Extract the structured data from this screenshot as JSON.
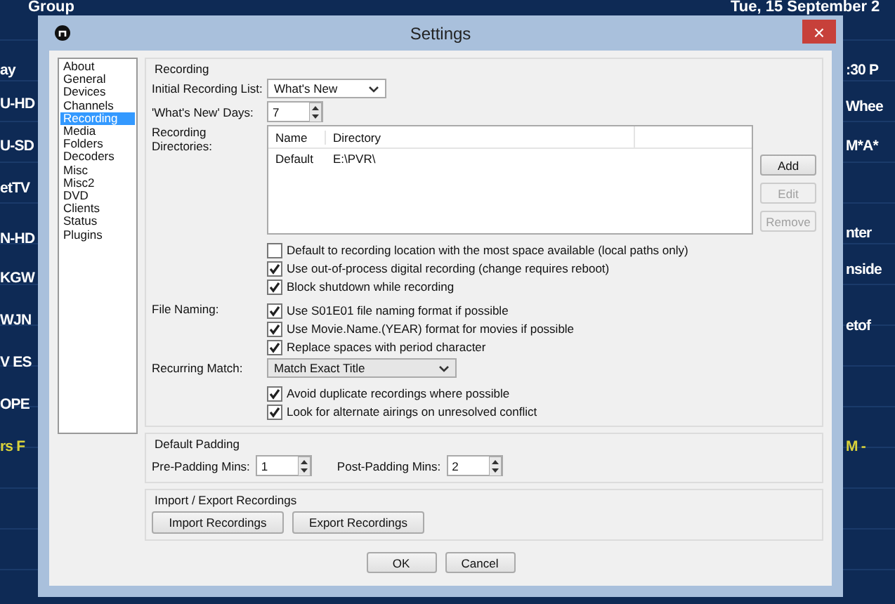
{
  "background": {
    "header_left": "Group",
    "header_right": "Tue, 15 September 2",
    "left_rows": [
      {
        "text": "ay",
        "highlighted": false
      },
      {
        "text": "U-HD",
        "highlighted": false
      },
      {
        "text": "U-SD",
        "highlighted": false
      },
      {
        "text": "etTV",
        "highlighted": false
      },
      {
        "text": "N-HD",
        "highlighted": false
      },
      {
        "text": "KGW",
        "highlighted": false
      },
      {
        "text": "WJN",
        "highlighted": false
      },
      {
        "text": "V ES",
        "highlighted": false
      },
      {
        "text": "OPE",
        "highlighted": false
      },
      {
        "text": "rs F",
        "highlighted": true
      }
    ],
    "right_rows": [
      {
        "text": ":30 P",
        "highlighted": false
      },
      {
        "text": "Whee",
        "highlighted": false
      },
      {
        "text": "M*A*",
        "highlighted": false
      },
      {
        "text": "nter",
        "highlighted": false
      },
      {
        "text": "nside",
        "highlighted": false
      },
      {
        "text": "etof",
        "highlighted": false
      },
      {
        "text": "M -",
        "highlighted": true
      }
    ]
  },
  "window": {
    "title": "Settings",
    "close": "×"
  },
  "sidebar": {
    "items": [
      {
        "label": "About",
        "selected": false
      },
      {
        "label": "General",
        "selected": false
      },
      {
        "label": "Devices",
        "selected": false
      },
      {
        "label": "Channels",
        "selected": false
      },
      {
        "label": "Recording",
        "selected": true
      },
      {
        "label": "Media Folders",
        "selected": false
      },
      {
        "label": "Decoders",
        "selected": false
      },
      {
        "label": "Misc",
        "selected": false
      },
      {
        "label": "Misc2",
        "selected": false
      },
      {
        "label": "DVD",
        "selected": false
      },
      {
        "label": "Clients",
        "selected": false
      },
      {
        "label": "Status",
        "selected": false
      },
      {
        "label": "Plugins",
        "selected": false
      }
    ]
  },
  "recording": {
    "title": "Recording",
    "initial_list": {
      "label": "Initial Recording List:",
      "value": "What's New"
    },
    "whats_new_days": {
      "label": "'What's New' Days:",
      "value": "7"
    },
    "directories": {
      "label": "Recording Directories:",
      "columns": [
        "Name",
        "Directory"
      ],
      "rows": [
        [
          "Default",
          "E:\\PVR\\"
        ]
      ],
      "buttons": [
        {
          "label": "Add",
          "disabled": false
        },
        {
          "label": "Edit",
          "disabled": true
        },
        {
          "label": "Remove",
          "disabled": true
        }
      ]
    },
    "options": [
      {
        "label": "Default to recording location with the most space available (local paths only)",
        "checked": false
      },
      {
        "label": "Use out-of-process digital recording (change requires reboot)",
        "checked": true
      },
      {
        "label": "Block shutdown while recording",
        "checked": true
      }
    ],
    "file_naming": {
      "label": "File Naming:",
      "options": [
        {
          "label": "Use S01E01 file naming format if possible",
          "checked": true
        },
        {
          "label": "Use Movie.Name.(YEAR) format for movies if possible",
          "checked": true
        },
        {
          "label": "Replace spaces with period character",
          "checked": true
        }
      ]
    },
    "recurring_match": {
      "label": "Recurring Match:",
      "value": "Match Exact Title",
      "options": [
        {
          "label": "Avoid duplicate recordings where possible",
          "checked": true
        },
        {
          "label": "Look for alternate airings on unresolved conflict",
          "checked": true
        }
      ]
    }
  },
  "default_padding": {
    "title": "Default Padding",
    "pre": {
      "label": "Pre-Padding Mins:",
      "value": "1"
    },
    "post": {
      "label": "Post-Padding Mins:",
      "value": "2"
    }
  },
  "import_export": {
    "title": "Import / Export Recordings",
    "buttons": [
      "Import Recordings",
      "Export Recordings"
    ]
  },
  "buttons": [
    "OK",
    "Cancel"
  ]
}
